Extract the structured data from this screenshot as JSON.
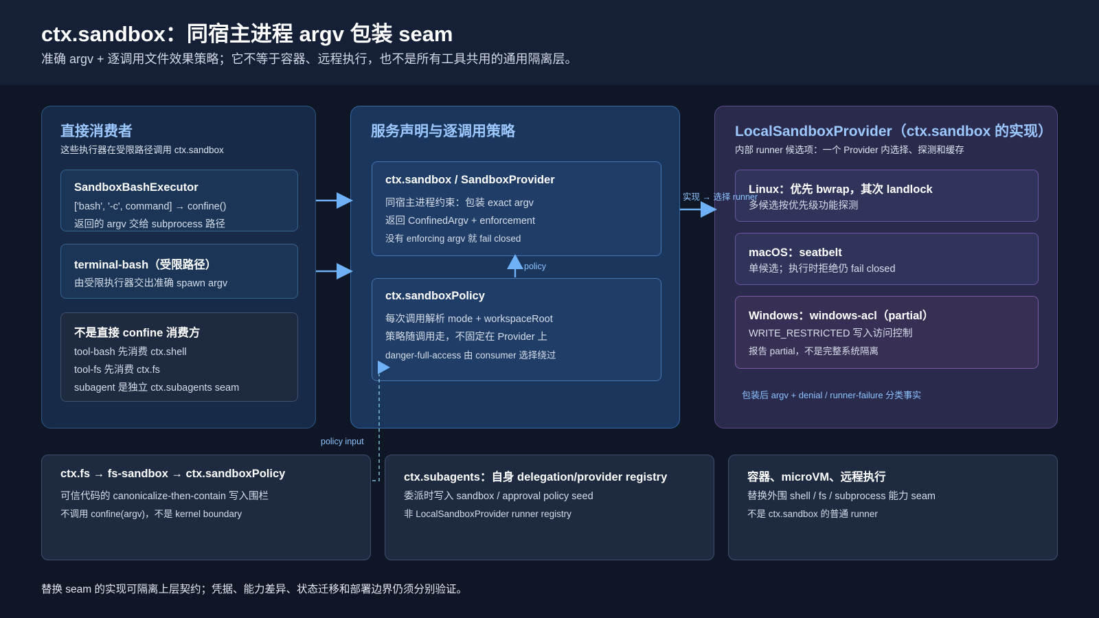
{
  "header": {
    "title": "ctx.sandbox：同宿主进程 argv 包装 seam",
    "subtitle": "准确 argv + 逐调用文件效果策略；它不等于容器、远程执行，也不是所有工具共用的通用隔离层。"
  },
  "consumers": {
    "title": "直接消费者",
    "subtitle": "这些执行器在受限路径调用 ctx.sandbox",
    "cards": [
      {
        "title": "SandboxBashExecutor",
        "lines": [
          "['bash', '-c', command] → confine()",
          "返回的 argv 交给 subprocess 路径"
        ]
      },
      {
        "title": "terminal-bash（受限路径）",
        "lines": [
          "由受限执行器交出准确 spawn argv"
        ]
      },
      {
        "title": "不是直接 confine 消费方",
        "lines": [
          "tool-bash 先消费 ctx.shell",
          "tool-fs 先消费 ctx.fs",
          "subagent 是独立 ctx.subagents seam"
        ]
      }
    ]
  },
  "policy": {
    "title": "服务声明与逐调用策略",
    "cards": [
      {
        "title": "ctx.sandbox / SandboxProvider",
        "lines": [
          "同宿主进程约束：包装 exact argv",
          "返回 ConfinedArgv + enforcement",
          "没有 enforcing argv 就 fail closed"
        ]
      },
      {
        "title": "ctx.sandboxPolicy",
        "lines": [
          "每次调用解析 mode + workspaceRoot",
          "策略随调用走，不固定在 Provider 上",
          "danger-full-access 由 consumer 选择绕过"
        ]
      }
    ]
  },
  "provider": {
    "title": "LocalSandboxProvider（ctx.sandbox 的实现）",
    "subtitle": "内部 runner 候选项：一个 Provider 内选择、探测和缓存",
    "cards": [
      {
        "title": "Linux：优先 bwrap，其次 landlock",
        "lines": [
          "多候选按优先级功能探测"
        ]
      },
      {
        "title": "macOS：seatbelt",
        "lines": [
          "单候选；执行时拒绝仍 fail closed"
        ]
      },
      {
        "title": "Windows：windows-acl（partial）",
        "lines": [
          "WRITE_RESTRICTED 写入访问控制",
          "报告 partial，不是完整系统隔离"
        ]
      }
    ],
    "note": "包装后 argv + denial / runner-failure 分类事实"
  },
  "edges": {
    "policy_label": "policy",
    "impl_label": "实现 → 选择 runner",
    "policy_input_label": "policy input"
  },
  "bottom": [
    {
      "title": "ctx.fs → fs-sandbox → ctx.sandboxPolicy",
      "lines": [
        "可信代码的 canonicalize-then-contain 写入围栏",
        "不调用 confine(argv)，不是 kernel boundary"
      ]
    },
    {
      "title": "ctx.subagents：自身 delegation/provider registry",
      "lines": [
        "委派时写入 sandbox / approval policy seed",
        "非 LocalSandboxProvider runner registry"
      ]
    },
    {
      "title": "容器、microVM、远程执行",
      "lines": [
        "替换外围 shell / fs / subprocess 能力 seam",
        "不是 ctx.sandbox 的普通 runner"
      ]
    }
  ],
  "footer": "替换 seam 的实现可隔离上层契约；凭据、能力差异、状态迁移和部署边界仍须分别验证。",
  "colors": {
    "accent": "#9cc8ff",
    "arrow": "#6fb1f7",
    "background": "#0f1626"
  }
}
